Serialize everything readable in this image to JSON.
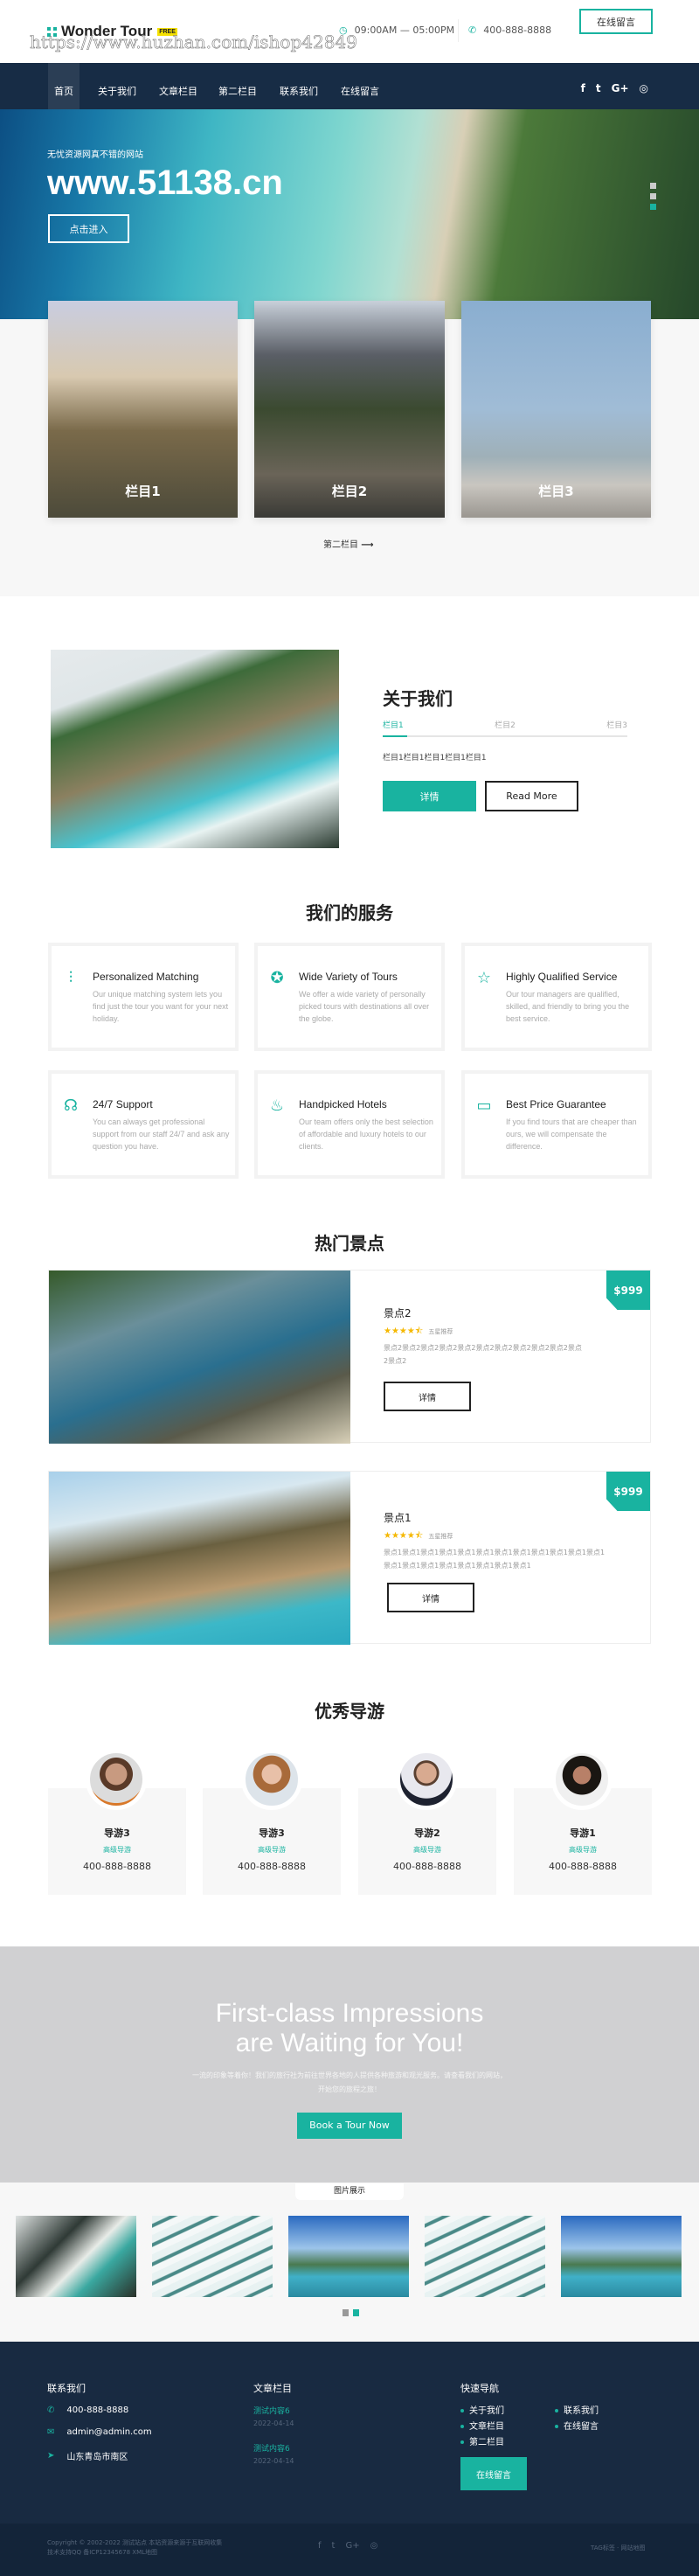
{
  "header": {
    "logo": "Wonder Tour",
    "logo_badge": "FREE",
    "hours": "09:00AM — 05:00PM",
    "phone": "400-888-8888",
    "cta": "在线留言",
    "watermark": "https://www.huzhan.com/ishop42849"
  },
  "nav": {
    "items": [
      "首页",
      "关于我们",
      "文章栏目",
      "第二栏目",
      "联系我们",
      "在线留言"
    ],
    "social": [
      "facebook-icon",
      "twitter-icon",
      "google-plus-icon",
      "instagram-icon"
    ]
  },
  "hero": {
    "subtitle": "无忧资源网真不错的网站",
    "title": "www.51138.cn",
    "button": "点击进入",
    "slides": 3,
    "active_slide": 3
  },
  "categories": {
    "cards": [
      "栏目1",
      "栏目2",
      "栏目3"
    ],
    "more": "第二栏目"
  },
  "about": {
    "title": "关于我们",
    "tabs": [
      "栏目1",
      "栏目2",
      "栏目3"
    ],
    "text": "栏目1栏目1栏目1栏目1栏目1",
    "btn_detail": "详情",
    "btn_more": "Read More"
  },
  "services": {
    "title": "我们的服务",
    "items": [
      {
        "icon": "sliders-icon",
        "title": "Personalized Matching",
        "text": "Our unique matching system lets you find just the tour you want for your next holiday."
      },
      {
        "icon": "award-icon",
        "title": "Wide Variety of Tours",
        "text": "We offer a wide variety of personally picked tours with destinations all over the globe."
      },
      {
        "icon": "star-icon",
        "title": "Highly Qualified Service",
        "text": "Our tour managers are qualified, skilled, and friendly to bring you the best service."
      },
      {
        "icon": "headset-icon",
        "title": "24/7 Support",
        "text": "You can always get professional support from our staff 24/7 and ask any question you have."
      },
      {
        "icon": "fire-icon",
        "title": "Handpicked Hotels",
        "text": "Our team offers only the best selection of affordable and luxury hotels to our clients."
      },
      {
        "icon": "wallet-icon",
        "title": "Best Price Guarantee",
        "text": "If you find tours that are cheaper than ours, we will compensate the difference."
      }
    ]
  },
  "spots": {
    "title": "热门景点",
    "items": [
      {
        "name": "景点2",
        "price": "$999",
        "rating": 4.5,
        "rating_label": "五星推荐",
        "text": "景点2景点2景点2景点2景点2景点2景点2景点2景点2景点2景点2景点2",
        "button": "详情"
      },
      {
        "name": "景点1",
        "price": "$999",
        "rating": 4.5,
        "rating_label": "五星推荐",
        "text": "景点1景点1景点1景点1景点1景点1景点1景点1景点1景点1景点1景点1景点1景点1景点1景点1景点1景点1景点1景点1",
        "button": "详情"
      }
    ]
  },
  "guides": {
    "title": "优秀导游",
    "items": [
      {
        "name": "导游3",
        "role": "高级导游",
        "phone": "400-888-8888"
      },
      {
        "name": "导游3",
        "role": "高级导游",
        "phone": "400-888-8888"
      },
      {
        "name": "导游2",
        "role": "高级导游",
        "phone": "400-888-8888"
      },
      {
        "name": "导游1",
        "role": "高级导游",
        "phone": "400-888-8888"
      }
    ]
  },
  "cta": {
    "line1": "First-class Impressions",
    "line2": "are Waiting for You!",
    "text": "一流的印象等着你！我们的旅行社为前往世界各地的人提供各种旅游和观光服务。请查看我们的网站，开始您的旅程之旅！",
    "button": "Book a Tour Now"
  },
  "gallery": {
    "label": "图片展示",
    "pages": 2,
    "active_page": 2
  },
  "footer": {
    "contact_title": "联系我们",
    "phone": "400-888-8888",
    "email": "admin@admin.com",
    "address": "山东青岛市南区",
    "articles_title": "文章栏目",
    "articles": [
      {
        "title": "测试内容6",
        "date": "2022-04-14"
      },
      {
        "title": "测试内容6",
        "date": "2022-04-14"
      }
    ],
    "quick_title": "快速导航",
    "quick": [
      "关于我们",
      "联系我们",
      "文章栏目",
      "在线留言",
      "第二栏目"
    ],
    "button": "在线留言",
    "copyright1": "Copyright © 2002-2022 测试站点 本站资源来源于互联网收集",
    "copyright2": "技术支持QQ 备ICP12345678 XML地图",
    "right_links": "TAG标签 · 网站地图"
  },
  "colors": {
    "accent": "#19b3a0",
    "nav": "#172c45",
    "footer": "#182a41"
  }
}
